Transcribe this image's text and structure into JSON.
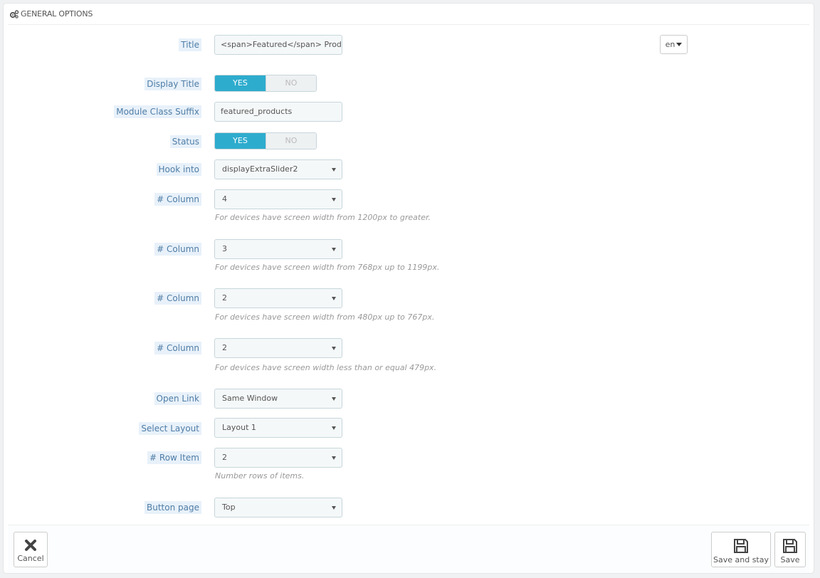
{
  "panel": {
    "heading": "GENERAL OPTIONS"
  },
  "fields": {
    "title": {
      "label": "Title",
      "value": "<span>Featured</span> Products",
      "lang": "en"
    },
    "display_title": {
      "label": "Display Title",
      "yes": "YES",
      "no": "NO",
      "value": "YES"
    },
    "module_class_suffix": {
      "label": "Module Class Suffix",
      "value": "featured_products"
    },
    "status": {
      "label": "Status",
      "yes": "YES",
      "no": "NO",
      "value": "YES"
    },
    "hook_into": {
      "label": "Hook into",
      "value": "displayExtraSlider2"
    },
    "column_lg": {
      "label": "# Column",
      "value": "4",
      "help": "For devices have screen width from 1200px to greater."
    },
    "column_md": {
      "label": "# Column",
      "value": "3",
      "help": "For devices have screen width from 768px up to 1199px."
    },
    "column_sm": {
      "label": "# Column",
      "value": "2",
      "help": "For devices have screen width from 480px up to 767px."
    },
    "column_xs": {
      "label": "# Column",
      "value": "2",
      "help": "For devices have screen width less than or equal 479px."
    },
    "open_link": {
      "label": "Open Link",
      "value": "Same Window"
    },
    "select_layout": {
      "label": "Select Layout",
      "value": "Layout 1"
    },
    "row_item": {
      "label": "# Row Item",
      "value": "2",
      "help": "Number rows of items."
    },
    "button_page": {
      "label": "Button page",
      "value": "Top"
    }
  },
  "footer": {
    "cancel": "Cancel",
    "save_and_stay": "Save and stay",
    "save": "Save"
  },
  "colors": {
    "accent": "#2eacce",
    "label_bg": "#e8f1fa",
    "label_text": "#4f7da6"
  }
}
